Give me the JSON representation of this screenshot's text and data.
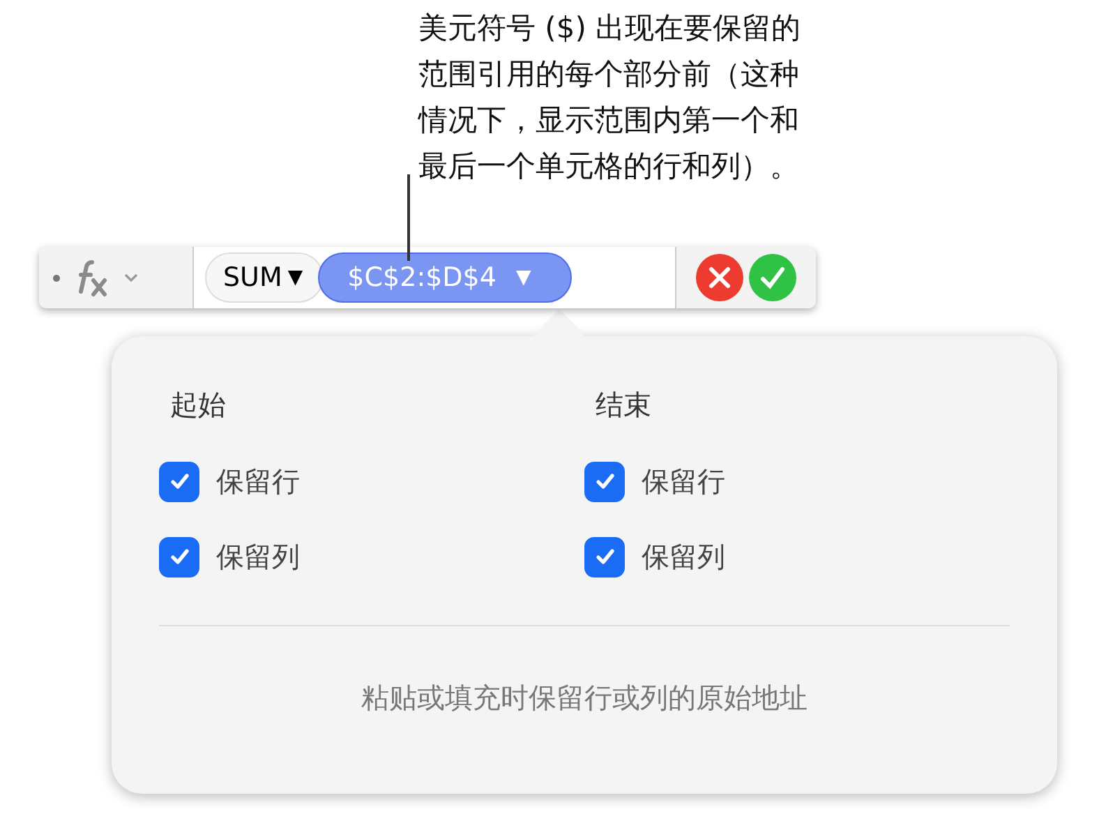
{
  "callout": {
    "lines": [
      "美元符号 ($) 出现在要保留的",
      "范围引用的每个部分前（这种",
      "情况下，显示范围内第一个和",
      "最后一个单元格的行和列）。"
    ]
  },
  "formula_bar": {
    "function": {
      "label": "SUM",
      "caret": "▼"
    },
    "range": {
      "label": "$C$2:$D$4",
      "caret": "▼",
      "selected": true
    }
  },
  "popover": {
    "columns": [
      {
        "title": "起始",
        "options": [
          {
            "label": "保留行",
            "checked": true
          },
          {
            "label": "保留列",
            "checked": true
          }
        ]
      },
      {
        "title": "结束",
        "options": [
          {
            "label": "保留行",
            "checked": true
          },
          {
            "label": "保留列",
            "checked": true
          }
        ]
      }
    ],
    "footer": "粘贴或填充时保留行或列的原始地址"
  }
}
